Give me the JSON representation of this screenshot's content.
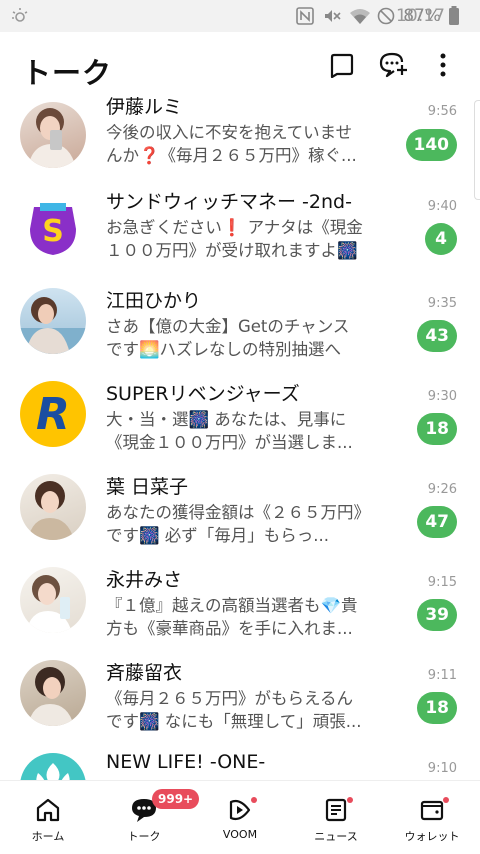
{
  "status_bar": {
    "battery": "87%",
    "time": "10:17"
  },
  "header": {
    "title": "トーク"
  },
  "chats": [
    {
      "name": "伊藤ルミ",
      "message": "今後の収入に不安を抱えていませんか❓《毎月２６５万円》稼ぐ...",
      "time": "9:56",
      "unread": "140",
      "avatar": "photo-woman-phone"
    },
    {
      "name": "サンドウィッチマネー -2nd-",
      "message": "お急ぎください❗ アナタは《現金１００万円》が受け取れますよ🎆",
      "time": "9:40",
      "unread": "4",
      "avatar": "logo-s"
    },
    {
      "name": "江田ひかり",
      "message": "さあ【億の大金】Getのチャンスです🌅ハズレなしの特別抽選へご...",
      "time": "9:35",
      "unread": "43",
      "avatar": "photo-woman-beach"
    },
    {
      "name": "SUPERリベンジャーズ",
      "message": "大・当・選🎆 あなたは、見事に《現金１００万円》が当選しま...",
      "time": "9:30",
      "unread": "18",
      "avatar": "logo-r"
    },
    {
      "name": "葉 日菜子",
      "message": "あなたの獲得金額は《２６５万円》です🎆 必ず「毎月」もらっ...",
      "time": "9:26",
      "unread": "47",
      "avatar": "photo-woman-smile"
    },
    {
      "name": "永井みさ",
      "message": "『１億』越えの高額当選者も💎貴方も《豪華商品》を手に入れま...",
      "time": "9:15",
      "unread": "39",
      "avatar": "photo-woman-glass"
    },
    {
      "name": "斉藤留衣",
      "message": "《毎月２６５万円》がもらえるんです🎆 なにも「無理して」頑張...",
      "time": "9:11",
      "unread": "18",
      "avatar": "photo-woman-towel"
    },
    {
      "name": "NEW LIFE! -ONE-",
      "message": "",
      "time": "9:10",
      "unread": "",
      "avatar": "logo-tree"
    }
  ],
  "nav": {
    "home": "ホーム",
    "talk": "トーク",
    "talk_badge": "999+",
    "voom": "VOOM",
    "news": "ニュース",
    "wallet": "ウォレット"
  },
  "colors": {
    "badge_green": "#4cb85d",
    "notify_red": "#e84c5c"
  }
}
